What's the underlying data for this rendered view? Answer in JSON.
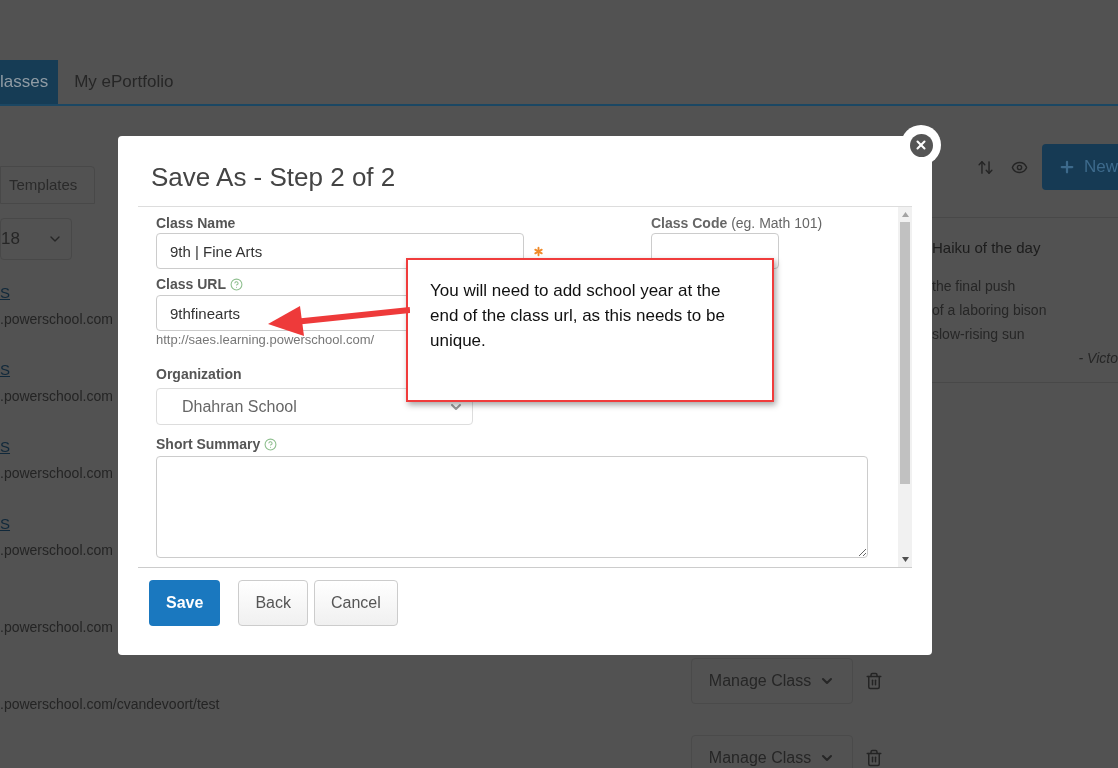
{
  "background": {
    "nav_tabs": [
      {
        "label": "lasses",
        "selected": true
      },
      {
        "label": "My ePortfolio",
        "selected": false
      }
    ],
    "sub_tabs": [
      {
        "label": "Templates",
        "selected": false
      }
    ],
    "year_select": {
      "value": "18"
    },
    "new_button": {
      "label": "New"
    },
    "classes": [
      {
        "name": "S",
        "url": ".powerschool.com"
      },
      {
        "name": "S",
        "url": ".powerschool.com"
      },
      {
        "name": "S",
        "url": ".powerschool.com"
      },
      {
        "name": "S",
        "url": ".powerschool.com"
      },
      {
        "url": ".powerschool.com"
      },
      {
        "url": ".powerschool.com/cvandevoort/test"
      }
    ],
    "manage_buttons": [
      {
        "label": "Manage Class"
      },
      {
        "label": "Manage Class"
      }
    ],
    "haiku": {
      "title": "Haiku of the day",
      "lines": [
        "the final push",
        "of a laboring bison",
        "slow-rising sun"
      ],
      "author": "- Victo"
    }
  },
  "dialog": {
    "title": "Save As - Step 2 of 2",
    "class_name": {
      "label": "Class Name",
      "value": "9th | Fine Arts",
      "required": true
    },
    "class_code": {
      "label": "**Class Code** (eg. Math 101)"
    },
    "class_url": {
      "label": "Class URL",
      "help": true,
      "value": "9thfinearts",
      "address": "http://saes.learning.powerschool.com/"
    },
    "organization": {
      "label": "Organization",
      "value": "Dhahran School"
    },
    "short_summary": {
      "label": "Short Summary",
      "help": true
    },
    "buttons": [
      {
        "label": "Save",
        "kind": "primary"
      },
      {
        "label": "Back",
        "kind": "default"
      },
      {
        "label": "Cancel",
        "kind": "default"
      }
    ]
  },
  "callout": {
    "text": "You will need to add school year at the end of the class url, as this needs to be unique."
  }
}
